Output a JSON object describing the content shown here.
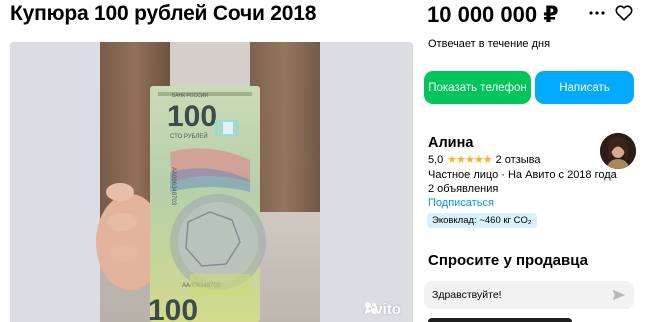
{
  "listing": {
    "title": "Купюра 100 рублей Сочи 2018",
    "price": "10 000 000 ₽"
  },
  "actions": {
    "more_icon": "more-dots-icon",
    "favorite_icon": "heart-icon"
  },
  "gallery": {
    "watermark": "Avito",
    "banknote": {
      "denomination": "100",
      "bank_text": "БАНК РОССИИ",
      "caption": "СТО РУБЛЕЙ",
      "serial": "АА006348703"
    }
  },
  "contact": {
    "reply_time": "Отвечает в течение дня",
    "show_phone_label": "Показать телефон",
    "write_label": "Написать"
  },
  "seller": {
    "name": "Алина",
    "rating": "5,0",
    "stars": "★★★★★",
    "reviews": "2 отзыва",
    "type_line": "Частное лицо · На Авито с 2018 года",
    "ads_count": "2 объявления",
    "subscribe": "Подписаться",
    "eco_badge": "Эковклад: ~460 кг CO₂"
  },
  "ask": {
    "title": "Спросите у продавца",
    "message_value": "Здравствуйте!"
  },
  "colors": {
    "green": "#02c55b",
    "blue": "#00aaff",
    "link": "#0099f7",
    "star": "#ffb021",
    "eco_bg": "#d8f1ff"
  }
}
